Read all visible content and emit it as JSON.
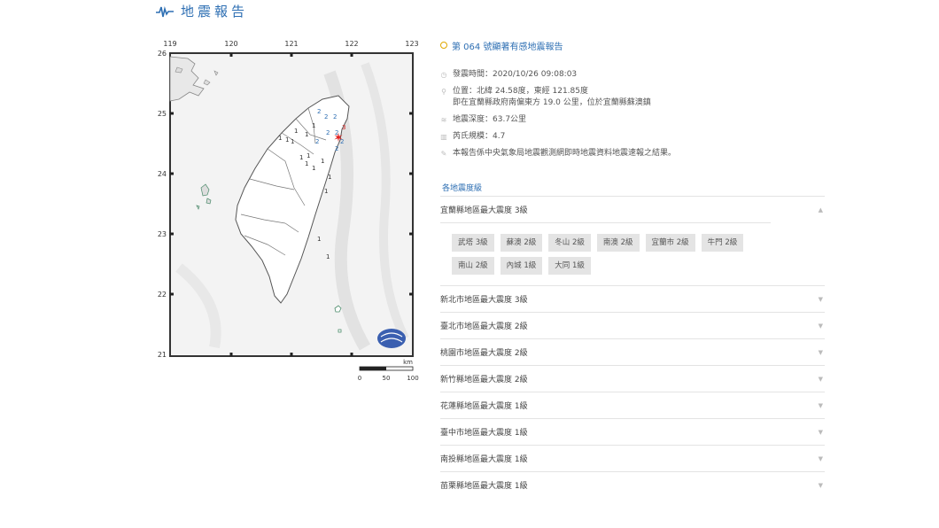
{
  "header": {
    "title": "地震報告"
  },
  "map": {
    "longitudes": [
      "119",
      "120",
      "121",
      "122",
      "123"
    ],
    "latitudes": [
      "26",
      "25",
      "24",
      "23",
      "22",
      "21"
    ],
    "scale": {
      "unit": "km",
      "labels": [
        "0",
        "50",
        "100"
      ]
    },
    "intensity_labels": [
      "1",
      "1",
      "1",
      "1",
      "1",
      "2",
      "2",
      "2",
      "2",
      "2",
      "2",
      "3",
      "2",
      "1",
      "1",
      "1",
      "2",
      "1",
      "1",
      "1",
      "1",
      "1",
      "1",
      "1"
    ]
  },
  "report": {
    "title": "第 064 號顯著有感地震報告",
    "time": "發震時間：2020/10/26 09:08:03",
    "location": "位置：北緯 24.58度，東經 121.85度",
    "location_detail": "即在宜蘭縣政府南偏東方 19.0 公里，位於宜蘭縣蘇澳鎮",
    "depth": "地震深度：63.7公里",
    "magnitude": "芮氏規模：4.7",
    "note": "本報告係中央氣象局地震觀測網即時地震資料地震速報之結果。"
  },
  "intensity_section": {
    "label": "各地震度級",
    "expanded": {
      "title": "宜蘭縣地區最大震度 3級",
      "stations": [
        "武塔 3級",
        "蘇澳 2級",
        "冬山 2級",
        "南澳 2級",
        "宜蘭市 2級",
        "牛門 2級",
        "南山 2級",
        "內城 1級",
        "大同 1級"
      ]
    },
    "regions": [
      "新北市地區最大震度 3級",
      "臺北市地區最大震度 2級",
      "桃園市地區最大震度 2級",
      "新竹縣地區最大震度 2級",
      "花蓮縣地區最大震度 1級",
      "臺中市地區最大震度 1級",
      "南投縣地區最大震度 1級",
      "苗栗縣地區最大震度 1級"
    ]
  }
}
